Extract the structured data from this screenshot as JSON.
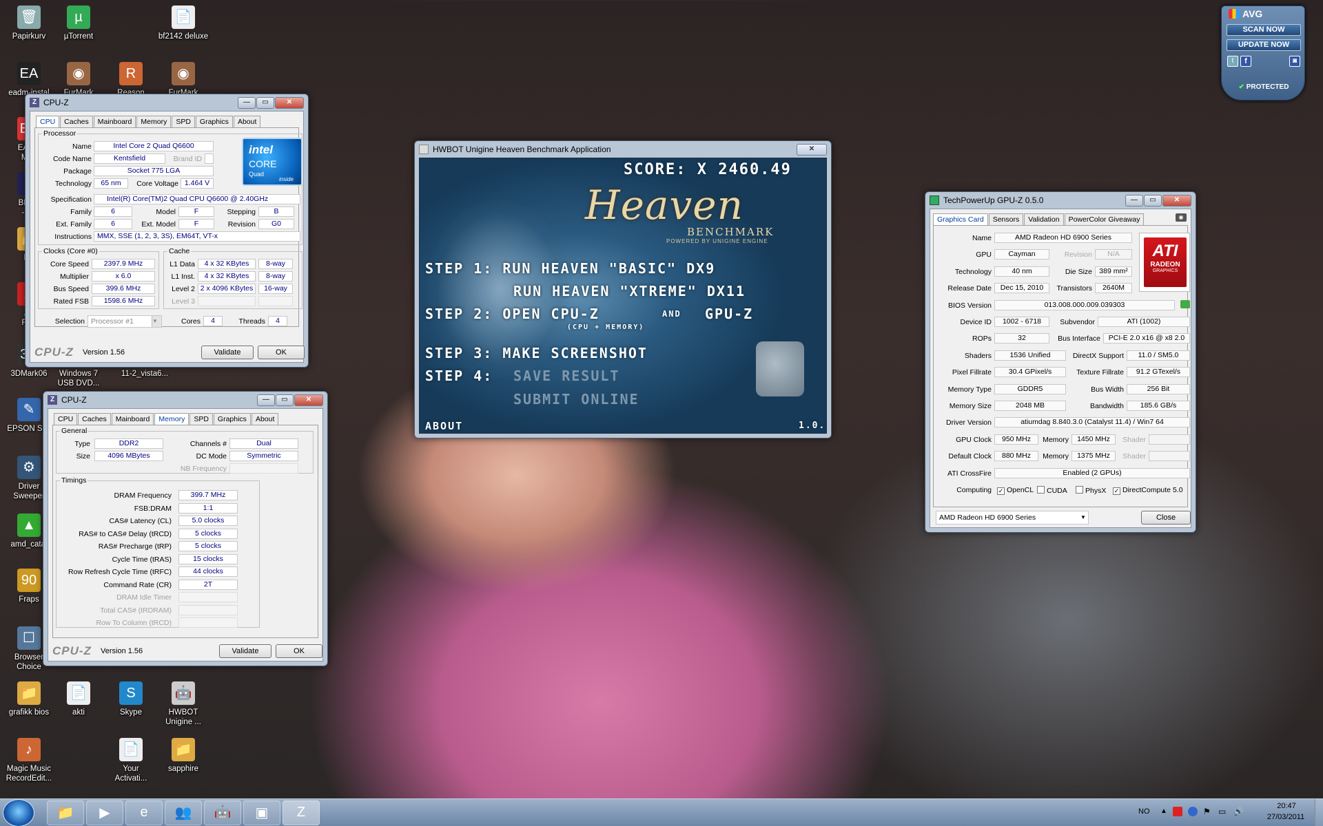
{
  "desktop_icons": [
    {
      "name": "icon-papirkurv",
      "label": "Papirkurv",
      "glyph": "🗑"
    },
    {
      "name": "icon-utorrent",
      "label": "µTorrent",
      "glyph": "µ"
    },
    {
      "name": "icon-bf2142",
      "label": "bf2142 deluxe",
      "glyph": "📄"
    },
    {
      "name": "icon-eadm",
      "label": "eadm-instal",
      "glyph": "EA"
    },
    {
      "name": "icon-furmark1",
      "label": "FurMark",
      "glyph": "◉"
    },
    {
      "name": "icon-reason",
      "label": "Reason",
      "glyph": "R"
    },
    {
      "name": "icon-furmark2",
      "label": "FurMark",
      "glyph": "◉"
    },
    {
      "name": "icon-ea-down",
      "label": "EA Do\nMan",
      "glyph": "EA"
    },
    {
      "name": "icon-bfbc",
      "label": "BFBC\n- Sh",
      "glyph": "B"
    },
    {
      "name": "icon-hw",
      "label": "hw",
      "glyph": "📁"
    },
    {
      "name": "icon-adobe",
      "label": "Ad\nRea",
      "glyph": "A"
    },
    {
      "name": "icon-3dmark06",
      "label": "3DMark06",
      "glyph": "3D"
    },
    {
      "name": "icon-win7dvd",
      "label": "Windows 7\nUSB DVD...",
      "glyph": ""
    },
    {
      "name": "icon-vista",
      "label": "11-2_vista6...",
      "glyph": ""
    },
    {
      "name": "icon-epson",
      "label": "EPSON Sca",
      "glyph": "✎"
    },
    {
      "name": "icon-driver-sweeper",
      "label": "Driver\nSweeper",
      "glyph": "⚙"
    },
    {
      "name": "icon-amd-catalyst",
      "label": "amd_catal",
      "glyph": "▲"
    },
    {
      "name": "icon-fraps",
      "label": "Fraps",
      "glyph": "90"
    },
    {
      "name": "icon-browser-choice",
      "label": "Browser\nChoice",
      "glyph": "☐"
    },
    {
      "name": "icon-grafikk-bios",
      "label": "grafikk bios",
      "glyph": "📁"
    },
    {
      "name": "icon-akti",
      "label": "akti",
      "glyph": "📄"
    },
    {
      "name": "icon-skype",
      "label": "Skype",
      "glyph": "S"
    },
    {
      "name": "icon-hwbot",
      "label": "HWBOT\nUnigine ...",
      "glyph": "🤖"
    },
    {
      "name": "icon-magic-music",
      "label": "Magic Music\nRecordEdit...",
      "glyph": "♪"
    },
    {
      "name": "icon-your-activation",
      "label": "Your\nActivati...",
      "glyph": "📄"
    },
    {
      "name": "icon-sapphire",
      "label": "sapphire",
      "glyph": "📁"
    }
  ],
  "avg": {
    "title": "AVG",
    "scan": "SCAN NOW",
    "update": "UPDATE NOW",
    "status": "PROTECTED"
  },
  "cpuz_cpu": {
    "title": "CPU-Z",
    "tabs": [
      "CPU",
      "Caches",
      "Mainboard",
      "Memory",
      "SPD",
      "Graphics",
      "About"
    ],
    "processor": "Processor",
    "name_lbl": "Name",
    "name": "Intel Core 2 Quad Q6600",
    "code_lbl": "Code Name",
    "code": "Kentsfield",
    "brand_lbl": "Brand ID",
    "pkg_lbl": "Package",
    "pkg": "Socket 775 LGA",
    "tech_lbl": "Technology",
    "tech": "65 nm",
    "volt_lbl": "Core Voltage",
    "volt": "1.464 V",
    "spec_lbl": "Specification",
    "spec": "Intel(R) Core(TM)2 Quad CPU    Q6600  @ 2.40GHz",
    "fam_lbl": "Family",
    "fam": "6",
    "model_lbl": "Model",
    "model": "F",
    "step_lbl": "Stepping",
    "step": "B",
    "efam_lbl": "Ext. Family",
    "efam": "6",
    "emodel_lbl": "Ext. Model",
    "emodel": "F",
    "rev_lbl": "Revision",
    "rev": "G0",
    "inst_lbl": "Instructions",
    "inst": "MMX, SSE (1, 2, 3, 3S), EM64T, VT-x",
    "clocks": "Clocks (Core #0)",
    "cache": "Cache",
    "cs_lbl": "Core Speed",
    "cs": "2397.9 MHz",
    "mul_lbl": "Multiplier",
    "mul": "x 6.0",
    "bus_lbl": "Bus Speed",
    "bus": "399.6 MHz",
    "fsb_lbl": "Rated FSB",
    "fsb": "1598.6 MHz",
    "l1d_lbl": "L1 Data",
    "l1d": "4 x 32 KBytes",
    "l1d_w": "8-way",
    "l1i_lbl": "L1 Inst.",
    "l1i": "4 x 32 KBytes",
    "l1i_w": "8-way",
    "l2_lbl": "Level 2",
    "l2": "2 x 4096 KBytes",
    "l2_w": "16-way",
    "l3_lbl": "Level 3",
    "sel_lbl": "Selection",
    "sel": "Processor #1",
    "cores_lbl": "Cores",
    "cores": "4",
    "threads_lbl": "Threads",
    "threads": "4",
    "logo": "CPU-Z",
    "version": "Version 1.56",
    "validate": "Validate",
    "ok": "OK",
    "intel_a": "intel",
    "intel_b": "CORE",
    "intel_c": "Quad",
    "intel_d": "inside"
  },
  "cpuz_mem": {
    "title": "CPU-Z",
    "tabs": [
      "CPU",
      "Caches",
      "Mainboard",
      "Memory",
      "SPD",
      "Graphics",
      "About"
    ],
    "general": "General",
    "type_lbl": "Type",
    "type": "DDR2",
    "ch_lbl": "Channels #",
    "ch": "Dual",
    "size_lbl": "Size",
    "size": "4096 MBytes",
    "dc_lbl": "DC Mode",
    "dc": "Symmetric",
    "nb_lbl": "NB Frequency",
    "timings": "Timings",
    "rows": [
      {
        "l": "DRAM Frequency",
        "v": "399.7 MHz",
        "g": false
      },
      {
        "l": "FSB:DRAM",
        "v": "1:1",
        "g": false
      },
      {
        "l": "CAS# Latency (CL)",
        "v": "5.0 clocks",
        "g": false
      },
      {
        "l": "RAS# to CAS# Delay (tRCD)",
        "v": "5 clocks",
        "g": false
      },
      {
        "l": "RAS# Precharge (tRP)",
        "v": "5 clocks",
        "g": false
      },
      {
        "l": "Cycle Time (tRAS)",
        "v": "15 clocks",
        "g": false
      },
      {
        "l": "Row Refresh Cycle Time (tRFC)",
        "v": "44 clocks",
        "g": false
      },
      {
        "l": "Command Rate (CR)",
        "v": "2T",
        "g": false
      },
      {
        "l": "DRAM Idle Timer",
        "v": "",
        "g": true
      },
      {
        "l": "Total CAS# (tRDRAM)",
        "v": "",
        "g": true
      },
      {
        "l": "Row To Column (tRCD)",
        "v": "",
        "g": true
      }
    ],
    "logo": "CPU-Z",
    "version": "Version 1.56",
    "validate": "Validate",
    "ok": "OK"
  },
  "heaven": {
    "title": "HWBOT Unigine Heaven Benchmark Application",
    "score": "SCORE: X 2460.49",
    "logo": "Heaven",
    "logo_sub": "BENCHMARK",
    "logo_pow": "POWERED BY UNIGINE ENGINE",
    "step1": "STEP 1:  RUN HEAVEN \"BASIC\" DX9",
    "step1b": "RUN HEAVEN \"XTREME\" DX11",
    "step2a": "STEP 2: OPEN CPU-Z",
    "step2and": "AND",
    "step2b": "GPU-Z",
    "step2sub": "(CPU + MEMORY)",
    "step3": "STEP 3: MAKE SCREENSHOT",
    "step4": "STEP 4:",
    "step4a": "SAVE RESULT",
    "step4b": "SUBMIT ONLINE",
    "about": "ABOUT",
    "version": "1.0.3"
  },
  "gpuz": {
    "title": "TechPowerUp GPU-Z 0.5.0",
    "tabs": [
      "Graphics Card",
      "Sensors",
      "Validation",
      "PowerColor Giveaway"
    ],
    "rows": {
      "name_l": "Name",
      "name": "AMD Radeon HD 6900 Series",
      "gpu_l": "GPU",
      "gpu": "Cayman",
      "rev_l": "Revision",
      "rev": "N/A",
      "tech_l": "Technology",
      "tech": "40 nm",
      "die_l": "Die Size",
      "die": "389 mm²",
      "rel_l": "Release Date",
      "rel": "Dec 15, 2010",
      "tr_l": "Transistors",
      "tr": "2640M",
      "bios_l": "BIOS Version",
      "bios": "013.008.000.009.039303",
      "dev_l": "Device ID",
      "dev": "1002 - 6718",
      "sub_l": "Subvendor",
      "sub": "ATI (1002)",
      "rop_l": "ROPs",
      "rop": "32",
      "bi_l": "Bus Interface",
      "bi": "PCI-E 2.0 x16 @ x8 2.0",
      "sh_l": "Shaders",
      "sh": "1536 Unified",
      "dx_l": "DirectX Support",
      "dx": "11.0 / SM5.0",
      "pf_l": "Pixel Fillrate",
      "pf": "30.4 GPixel/s",
      "tf_l": "Texture Fillrate",
      "tf": "91.2 GTexel/s",
      "mt_l": "Memory Type",
      "mt": "GDDR5",
      "bw_l": "Bus Width",
      "bw": "256 Bit",
      "ms_l": "Memory Size",
      "ms": "2048 MB",
      "band_l": "Bandwidth",
      "band": "185.6 GB/s",
      "drv_l": "Driver Version",
      "drv": "atiumdag 8.840.3.0 (Catalyst 11.4) / Win7 64",
      "gc_l": "GPU Clock",
      "gc": "950 MHz",
      "mem_l": "Memory",
      "gcm": "1450 MHz",
      "shd_l": "Shader",
      "dc_l": "Default Clock",
      "dc": "880 MHz",
      "dcm": "1375 MHz",
      "cf_l": "ATI CrossFire",
      "cf": "Enabled (2 GPUs)",
      "cmp_l": "Computing",
      "opencl": "OpenCL",
      "cuda": "CUDA",
      "physx": "PhysX",
      "dcomp": "DirectCompute 5.0"
    },
    "select": "AMD Radeon HD 6900 Series",
    "close": "Close",
    "ati_a": "ATI",
    "ati_b": "RADEON",
    "ati_c": "GRAPHICS"
  },
  "taskbar": {
    "lang": "NO",
    "time": "20:47",
    "date": "27/03/2011"
  }
}
